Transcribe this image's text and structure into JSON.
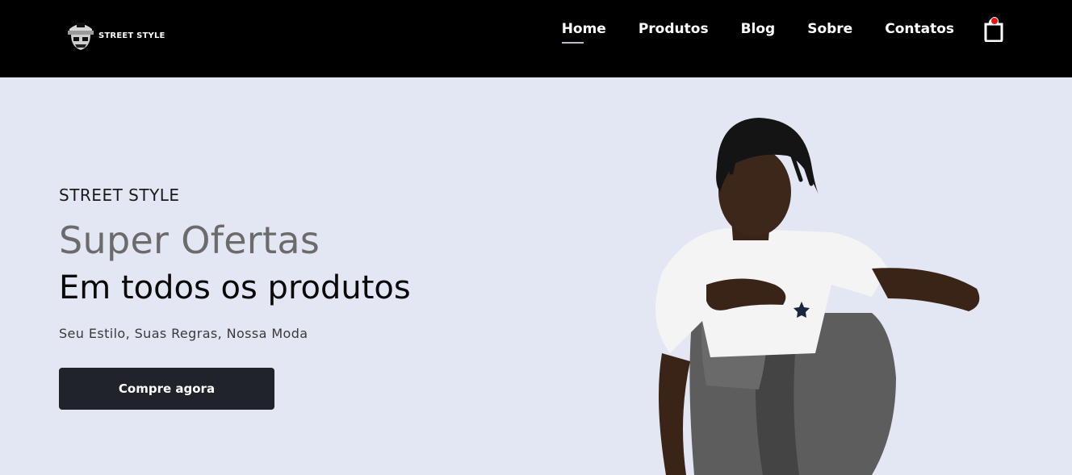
{
  "brand": {
    "name": "STREET STYLE",
    "icon": "skull-cap-icon"
  },
  "nav": {
    "items": [
      {
        "label": "Home",
        "active": true
      },
      {
        "label": "Produtos",
        "active": false
      },
      {
        "label": "Blog",
        "active": false
      },
      {
        "label": "Sobre",
        "active": false
      },
      {
        "label": "Contatos",
        "active": false
      }
    ],
    "cart_icon": "shopping-bag-icon",
    "cart_badge_color": "#e11616"
  },
  "hero": {
    "eyebrow": "STREET STYLE",
    "headline_1": "Super Ofertas",
    "headline_2": "Em todos os produtos",
    "tagline": "Seu Estilo, Suas Regras, Nossa Moda",
    "cta_label": "Compre agora",
    "image": "young-man-crouching-photo"
  },
  "colors": {
    "navbar_bg": "#000000",
    "hero_bg": "#e3e6f3",
    "cta_bg": "#202329",
    "headline_muted": "#6b6b6b"
  }
}
